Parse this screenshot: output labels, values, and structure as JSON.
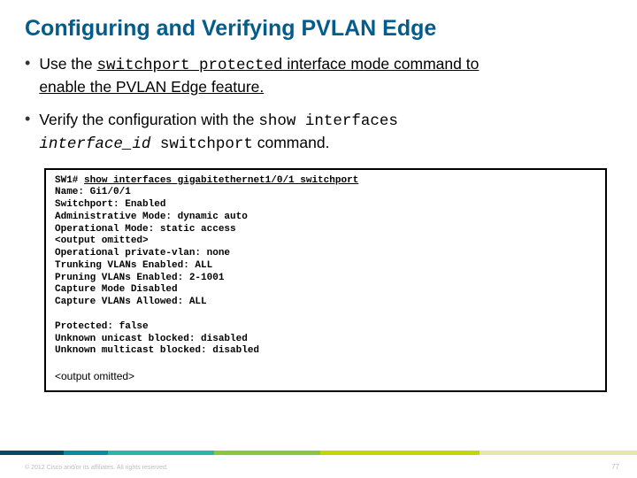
{
  "title": "Configuring and Verifying PVLAN Edge",
  "bullets": {
    "b1": {
      "pre": "Use the ",
      "cmd": "switchport protected",
      "post1": " interface mode command to",
      "post2": "enable the PVLAN Edge feature."
    },
    "b2": {
      "pre": "Verify the configuration with the ",
      "cmd1": "show interfaces",
      "cmd2_italic": "interface_id",
      "cmd2_rest": " switchport",
      "post": " command."
    }
  },
  "code": {
    "l0a": "SW1# ",
    "l0b": "show interfaces gigabitethernet1/0/1 switchport",
    "l1": "Name: Gi1/0/1",
    "l2": "Switchport: Enabled",
    "l3": "Administrative Mode: dynamic auto",
    "l4": "Operational Mode: static access",
    "l5": "<output omitted>",
    "l6": "Operational private-vlan: none",
    "l7": "Trunking VLANs Enabled: ALL",
    "l8": "Pruning VLANs Enabled: 2-1001",
    "l9": "Capture Mode Disabled",
    "l10": "Capture VLANs Allowed: ALL",
    "l11": "Protected: false",
    "l12": "Unknown unicast blocked: disabled",
    "l13": "Unknown multicast blocked: disabled",
    "l14": "<output omitted>"
  },
  "footer": {
    "copyright": "© 2012 Cisco and/or its affiliates. All rights reserved.",
    "page": "77"
  }
}
